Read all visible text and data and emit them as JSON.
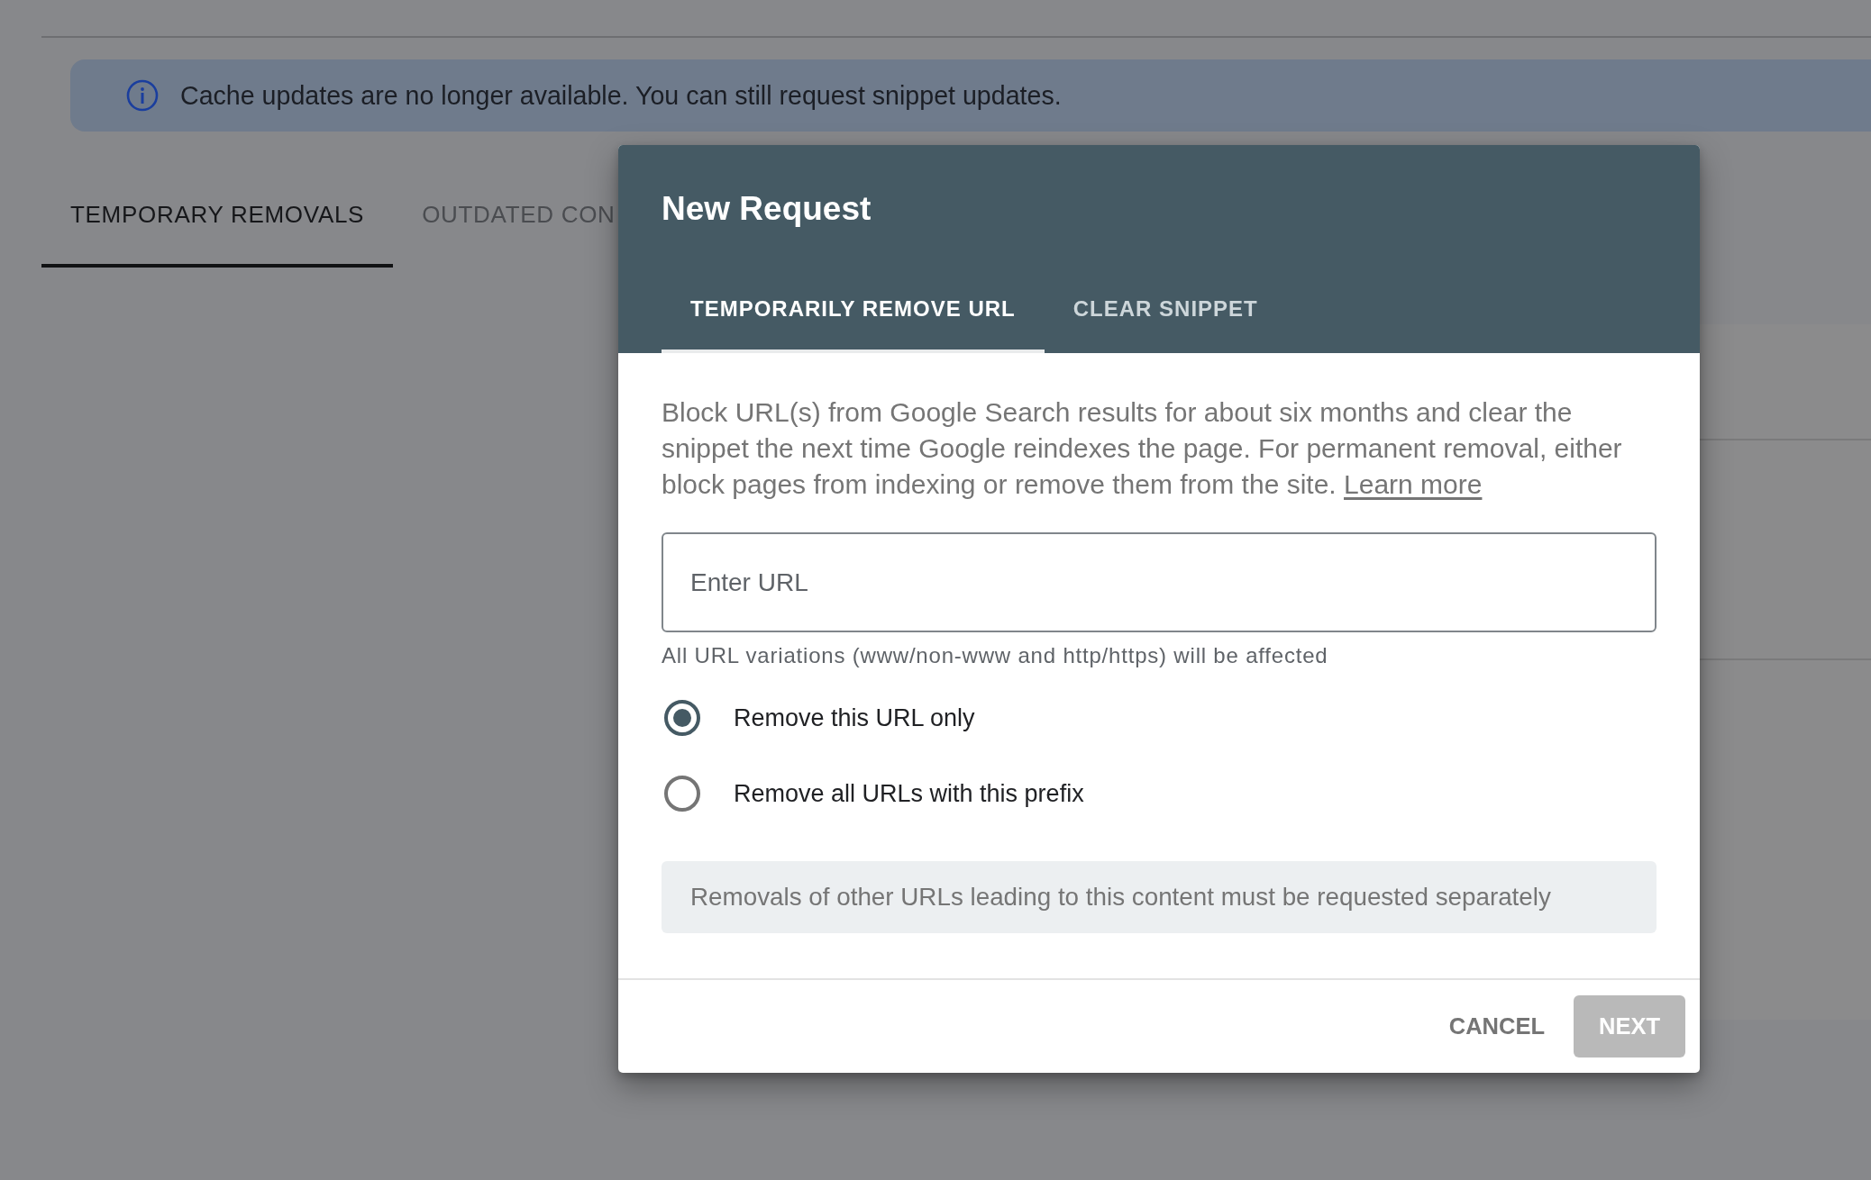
{
  "banner": {
    "text": "Cache updates are no longer available. You can still request snippet updates."
  },
  "tabs": [
    {
      "label": "TEMPORARY REMOVALS",
      "selected": true
    },
    {
      "label": "OUTDATED CON",
      "selected": false
    }
  ],
  "dialog": {
    "title": "New Request",
    "tabs": [
      {
        "label": "TEMPORARILY REMOVE URL",
        "selected": true
      },
      {
        "label": "CLEAR SNIPPET",
        "selected": false
      }
    ],
    "description": "Block URL(s) from Google Search results for about six months and clear the snippet the next time Google reindexes the page. For permanent removal, either block pages from indexing or remove them from the site.",
    "link": "Learn more",
    "url_field": {
      "placeholder": "Enter URL"
    },
    "helper_text": "All URL variations (www/non-www and http/https) will be affected",
    "options": [
      {
        "label": "Remove this URL only",
        "selected": true
      },
      {
        "label": "Remove all URLs with this prefix",
        "selected": false
      }
    ],
    "note": "Removals of other URLs leading to this content must be requested separately",
    "buttons": [
      {
        "label": "CANCEL",
        "kind": "text",
        "disabled": false
      },
      {
        "label": "NEXT",
        "kind": "contained",
        "disabled": true
      }
    ]
  }
}
